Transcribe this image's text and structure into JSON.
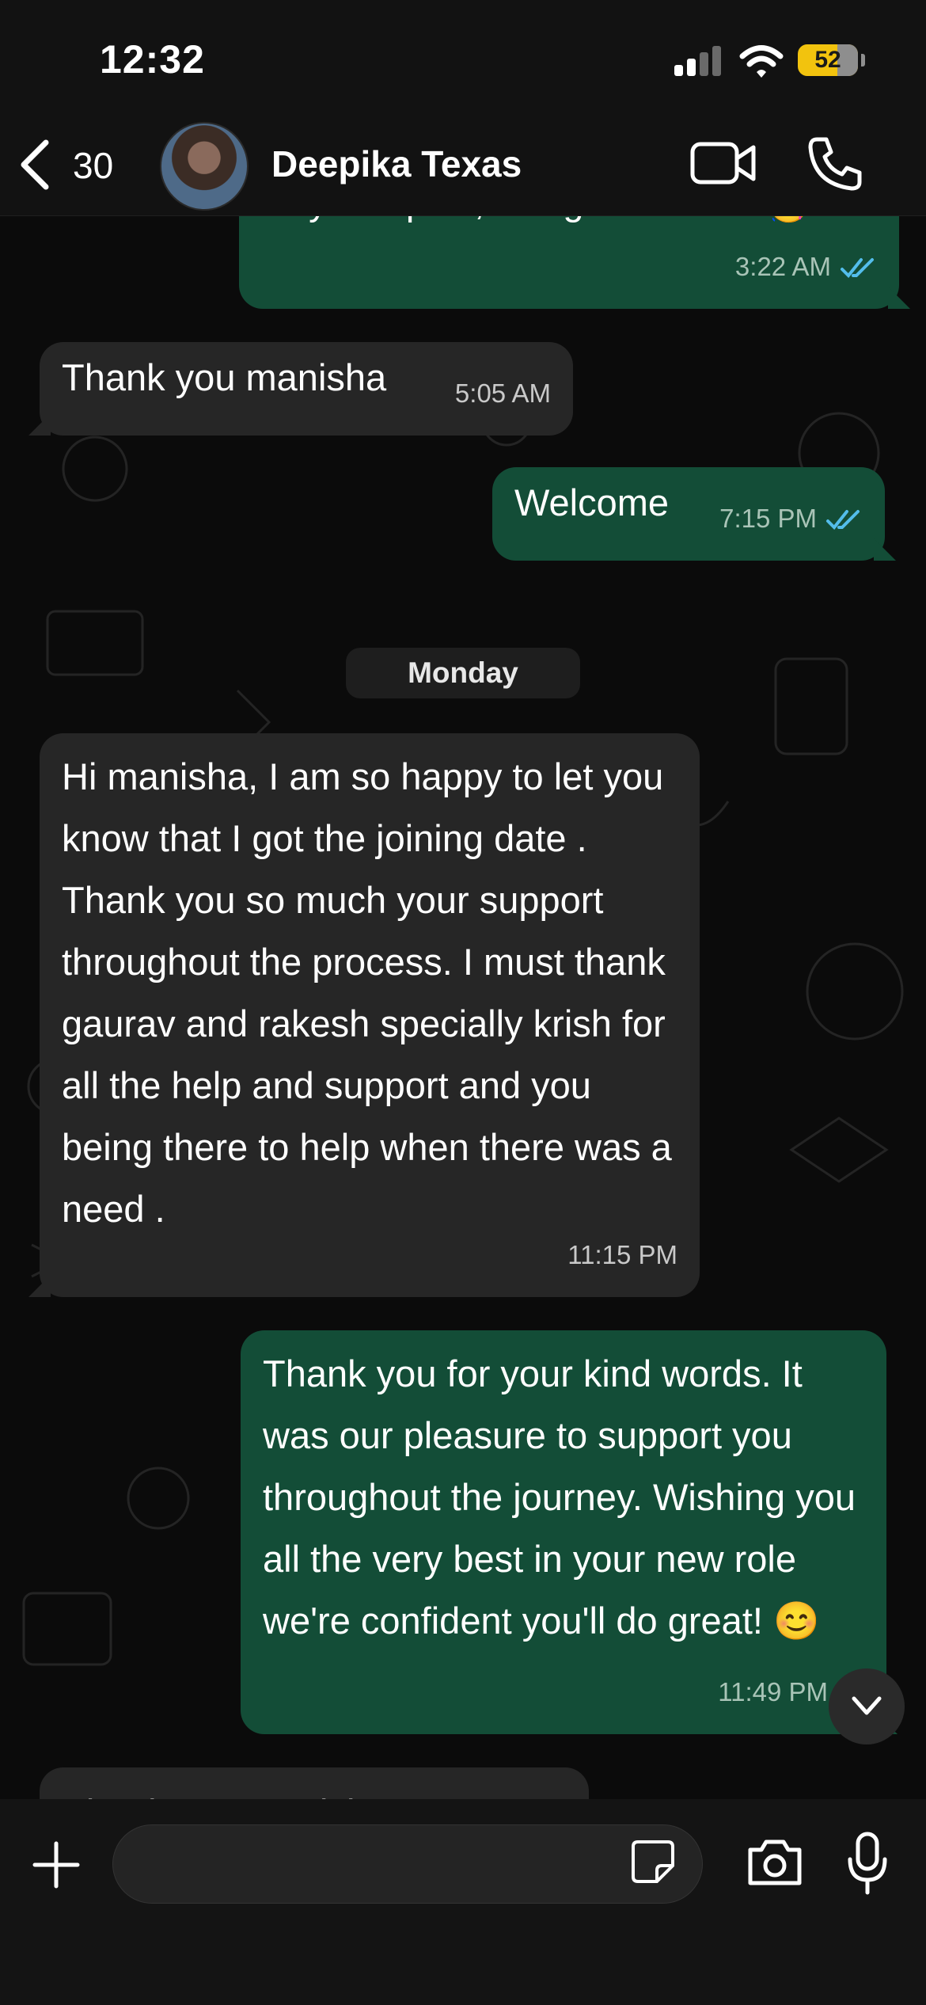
{
  "status_bar": {
    "time": "12:32",
    "battery": "52"
  },
  "header": {
    "back_count": "30",
    "contact_name": "Deepika Texas"
  },
  "messages": [
    {
      "direction": "outgoing",
      "text": "Hey Deepika, Congratulations 🥳",
      "time": "3:22 AM",
      "read": true
    },
    {
      "direction": "incoming",
      "text": "Thank you manisha",
      "time": "5:05 AM"
    },
    {
      "direction": "outgoing",
      "text": "Welcome",
      "time": "7:15 PM",
      "read": true
    },
    {
      "direction": "incoming",
      "text": "Hi manisha, I am so happy to let you know that I got the joining date . Thank you so much your support throughout the process. I must thank gaurav and rakesh specially krish for all the help and support and you being there to help when there was a need .",
      "time": "11:15 PM"
    },
    {
      "direction": "outgoing",
      "text": "Thank you for your kind words. It was our pleasure to support you throughout the journey. Wishing you all the very best in your new role we're confident you'll do great! 😊",
      "time": "11:49 PM"
    },
    {
      "direction": "incoming",
      "text": "Thank you manisha"
    }
  ],
  "day_separator": "Monday",
  "composer": {
    "placeholder": ""
  },
  "colors": {
    "outgoing_bubble": "#134d37",
    "incoming_bubble": "#262626",
    "read_ticks": "#53bdeb",
    "battery": "#f2c30e"
  },
  "icons": [
    "back-chevron-icon",
    "video-call-icon",
    "phone-call-icon",
    "scroll-down-icon",
    "plus-icon",
    "sticker-icon",
    "camera-icon",
    "microphone-icon",
    "read-ticks-icon"
  ]
}
